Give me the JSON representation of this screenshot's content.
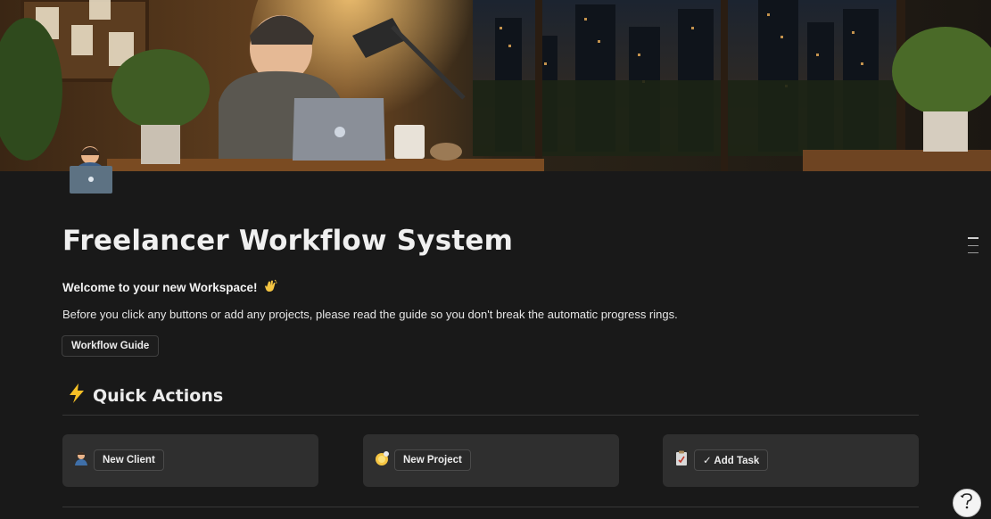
{
  "page": {
    "title": "Freelancer Workflow System",
    "welcome": "Welcome to your new Workspace!",
    "welcome_emoji": "waving-hand",
    "intro": "Before you click any buttons or add any projects, please read the guide so you don't break the automatic progress rings.",
    "guide_button": "Workflow Guide",
    "cover": "lofi-night-desk-illustration",
    "page_icon": "person-with-laptop-icon"
  },
  "quick_actions": {
    "heading": "Quick Actions",
    "heading_icon": "lightning-icon",
    "cards": [
      {
        "icon": "office-worker-icon",
        "label": "New Client"
      },
      {
        "icon": "new-badge-icon",
        "label": "New Project"
      },
      {
        "icon": "clipboard-icon",
        "label": "✓ Add Task"
      }
    ]
  },
  "colors": {
    "background": "#191919",
    "card": "#2f2f2f",
    "text": "#ececec"
  }
}
